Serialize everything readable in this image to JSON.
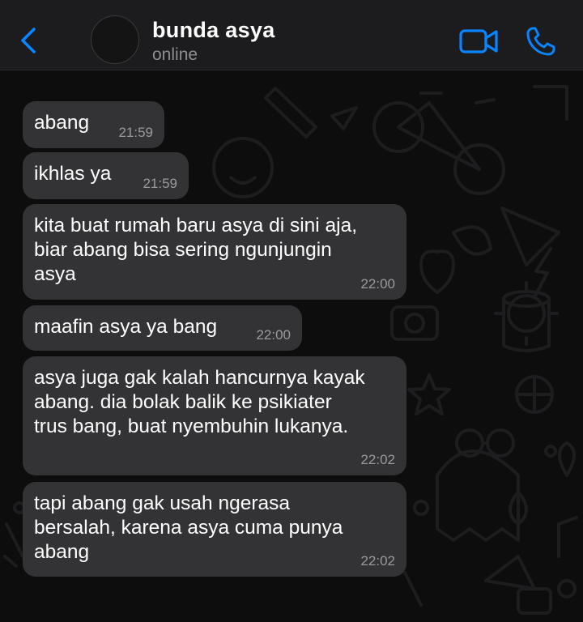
{
  "header": {
    "contact_name": "bunda asya",
    "status": "online",
    "accent_color": "#0a84ff"
  },
  "icons": {
    "back": "chevron-left-icon",
    "video": "video-camera-icon",
    "call": "phone-icon"
  },
  "messages": [
    {
      "text": "abang",
      "time": "21:59"
    },
    {
      "text": "ikhlas ya",
      "time": "21:59"
    },
    {
      "text": "kita buat rumah baru asya di sini aja,\nbiar abang bisa sering ngunjungin\nasya",
      "time": "22:00"
    },
    {
      "text": "maafin asya ya bang",
      "time": "22:00"
    },
    {
      "text": "asya juga gak kalah hancurnya kayak\nabang. dia bolak balik ke psikiater\ntrus bang, buat nyembuhin lukanya.",
      "time": "22:02"
    },
    {
      "text": "tapi abang gak usah ngerasa\nbersalah, karena asya cuma punya\nabang",
      "time": "22:02"
    }
  ]
}
